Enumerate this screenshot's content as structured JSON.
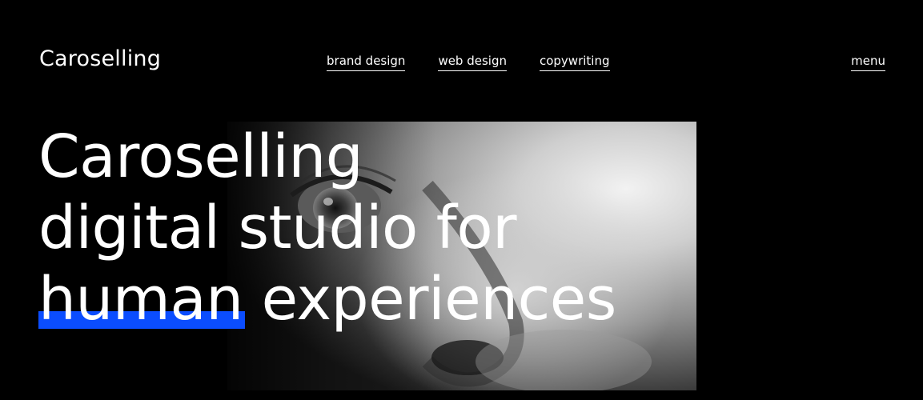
{
  "header": {
    "logo": "Caroselling",
    "nav": [
      {
        "label": "brand design"
      },
      {
        "label": "web design"
      },
      {
        "label": "copywriting"
      }
    ],
    "menu_label": "menu"
  },
  "hero": {
    "line1": "Caroselling",
    "line2": "digital studio for",
    "line3_highlight": "human",
    "line3_rest": " experiences",
    "highlight_color": "#0b4dff"
  }
}
